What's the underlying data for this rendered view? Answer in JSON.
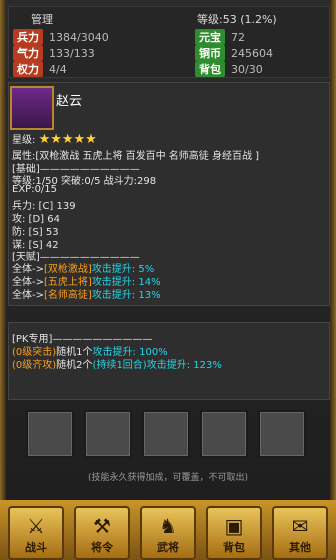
{
  "header": {
    "role": "管理",
    "level_text": "等级:53 (1.2%)"
  },
  "stats": {
    "hp": {
      "label": "兵力",
      "value": "1384/3040"
    },
    "morale": {
      "label": "气力",
      "value": "133/133"
    },
    "power": {
      "label": "权力",
      "value": "4/4"
    },
    "gems": {
      "label": "元宝",
      "value": "72"
    },
    "coins": {
      "label": "铜币",
      "value": "245604"
    },
    "bag": {
      "label": "背包",
      "value": "30/30"
    }
  },
  "general": {
    "name": "赵云",
    "star_label": "星级:",
    "stars": "★★★★★",
    "attributes": "属性:[双枪激战 五虎上将 百发百中 名师高徒 身经百战 ]",
    "basic_header": "[基础]——————————",
    "level_line": "等级:1/50  突破:0/5 战斗力:298",
    "exp": "EXP:0/15",
    "troops": "兵力:    [C]  139",
    "attack": "攻:    [D]  64",
    "defense": "防:    [S]  53",
    "strategy": "谋:    [S]  42"
  },
  "talent": {
    "header": "[天赋]——————————",
    "items": [
      {
        "prefix": "全体->",
        "name": "[双枪激战]",
        "effect": "攻击提升: 5%"
      },
      {
        "prefix": "全体->",
        "name": "[五虎上将]",
        "effect": "攻击提升: 14%"
      },
      {
        "prefix": "全体->",
        "name": "[名师高徒]",
        "effect": "攻击提升: 13%"
      }
    ]
  },
  "pk": {
    "header": "[PK专用]——————————",
    "lines": [
      {
        "name": "(0级突击)",
        "text": "随机1个",
        "effect": "攻击提升: 100%"
      },
      {
        "name": "(0级齐攻)",
        "text": "随机2个",
        "effect": "(持续1回合)攻击提升: 123%"
      }
    ]
  },
  "skills_note": "(技能永久获得加成，可覆盖，不可取出)",
  "toolbar": {
    "items": [
      {
        "icon": "⚔",
        "label": "战斗"
      },
      {
        "icon": "⚒",
        "label": "将令"
      },
      {
        "icon": "♞",
        "label": "武将"
      },
      {
        "icon": "▣",
        "label": "背包"
      },
      {
        "icon": "✉",
        "label": "其他"
      }
    ]
  }
}
